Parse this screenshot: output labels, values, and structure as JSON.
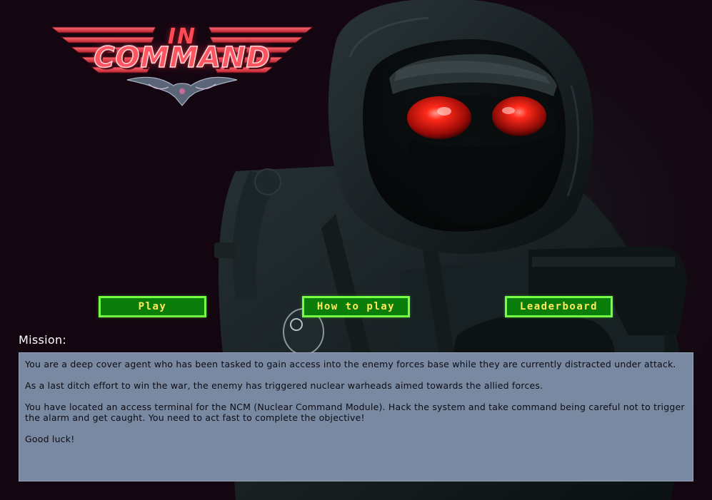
{
  "logo": {
    "line1": "IN",
    "line2": "COMMAND"
  },
  "menu": {
    "play_label": "Play",
    "how_to_play_label": "How to play",
    "leaderboard_label": "Leaderboard"
  },
  "mission": {
    "heading": "Mission:",
    "paragraphs": [
      "You are a deep cover agent who has been tasked to gain access into the enemy forces base while they are currently distracted under attack.",
      "As a last ditch effort to win the war, the enemy has triggered nuclear warheads aimed towards the allied forces.",
      "You have located an access terminal for the NCM (Nuclear Command Module). Hack the system and take command being careful not to trigger the alarm and get caught. You need to act fast to complete the objective!",
      "Good luck!"
    ]
  },
  "colors": {
    "background": "#140611",
    "button_fill": "#0a7d0a",
    "button_border": "#74ff45",
    "button_text": "#ffea5a",
    "mission_box": "#7989a2",
    "logo_red": "#ff5560"
  },
  "icons": {
    "hero": "hooded-soldier-illustration",
    "logo": "in-command-winged-emblem"
  }
}
